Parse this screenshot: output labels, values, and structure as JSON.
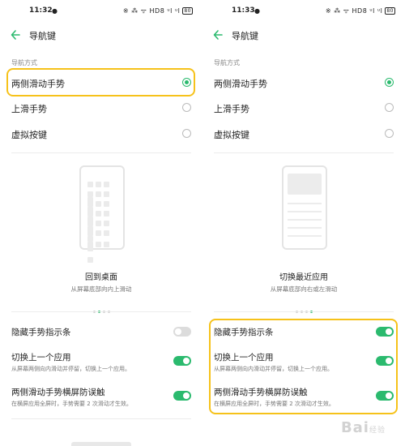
{
  "colors": {
    "accent": "#2bba6e",
    "highlight": "#f6c21a"
  },
  "left": {
    "status": {
      "time": "11:32",
      "dot": "●",
      "icons": "※ ⁂ ᯤ HD8 ᵘl ᵘl",
      "battery": "80"
    },
    "header": {
      "title": "导航键",
      "back_icon": "arrow-left-icon"
    },
    "section_title": "导航方式",
    "options": [
      "两侧滑动手势",
      "上滑手势",
      "虚拟按键"
    ],
    "selected_option": 0,
    "preview": {
      "caption": "回到桌面",
      "subcaption": "从屏幕底部向内上滑动",
      "page_indicator": {
        "count": 4,
        "active": 1
      }
    },
    "toggles": [
      {
        "title": "隐藏手势指示条",
        "desc": "",
        "on": false
      },
      {
        "title": "切换上一个应用",
        "desc": "从屏幕两侧向内滑动并停留，切换上一个应用。",
        "on": true
      },
      {
        "title": "两侧滑动手势横屏防误触",
        "desc": "在横屏应用全屏时，手势需要 2 次滑动才生效。",
        "on": true
      }
    ]
  },
  "right": {
    "status": {
      "time": "11:33",
      "dot": "●",
      "icons": "※ ⁂ ᯤ HD8 ᵘl ᵘl",
      "battery": "80"
    },
    "header": {
      "title": "导航键",
      "back_icon": "arrow-left-icon"
    },
    "section_title": "导航方式",
    "options": [
      "两侧滑动手势",
      "上滑手势",
      "虚拟按键"
    ],
    "selected_option": 0,
    "preview": {
      "caption": "切换最近应用",
      "subcaption": "从屏幕底部向右或左滑动",
      "page_indicator": {
        "count": 4,
        "active": 3
      }
    },
    "toggles": [
      {
        "title": "隐藏手势指示条",
        "desc": "",
        "on": true
      },
      {
        "title": "切换上一个应用",
        "desc": "从屏幕两侧向内滑动并停留，切换上一个应用。",
        "on": true
      },
      {
        "title": "两侧滑动手势横屏防误触",
        "desc": "在横屏应用全屏时，手势需要 2 次滑动才生效。",
        "on": true
      }
    ]
  },
  "watermark": {
    "text": "Bai",
    "small": "经验"
  }
}
